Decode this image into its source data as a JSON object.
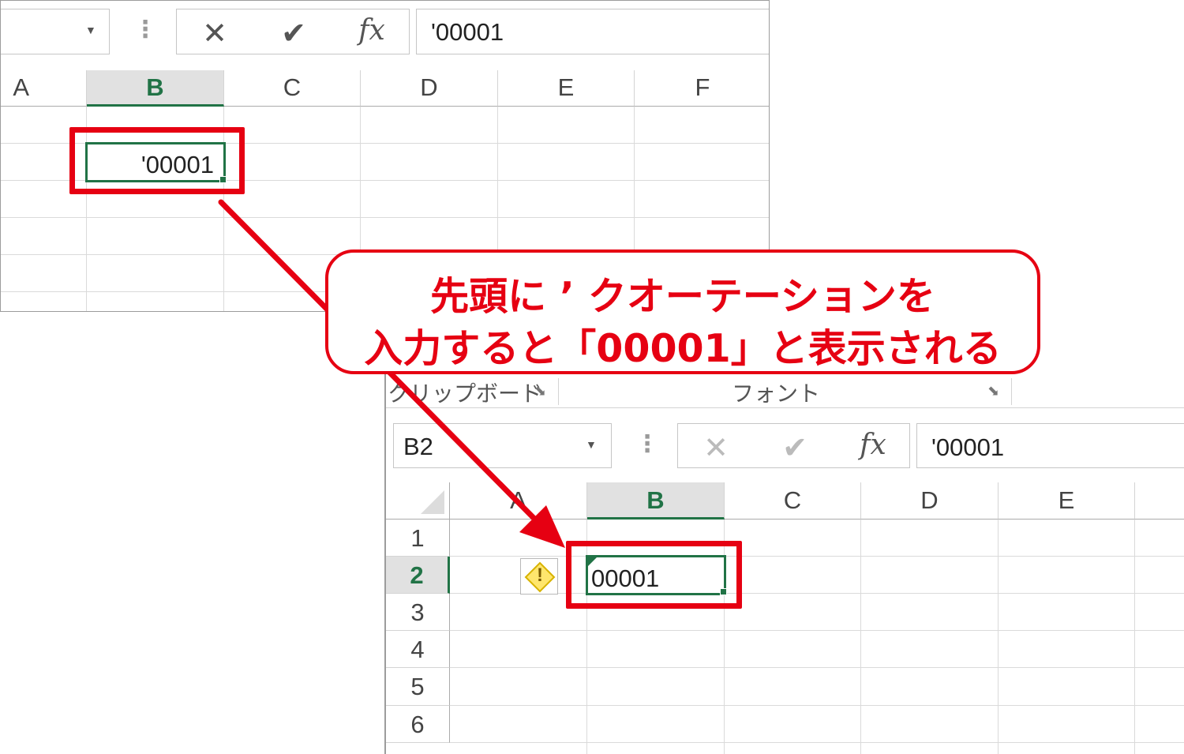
{
  "top_window": {
    "formula_bar": {
      "cancel_glyph": "✕",
      "enter_glyph": "✔",
      "fx_label": "fx",
      "value": "'00001"
    },
    "columns": [
      "A",
      "B",
      "C",
      "D",
      "E",
      "F"
    ],
    "selected_column": "B",
    "cell_b2_value": "'00001"
  },
  "callout": {
    "line1": "先頭に ’ クオーテーションを",
    "line2": "入力すると「00001」と表示される"
  },
  "bottom_window": {
    "ribbon": {
      "clipboard_label": "クリップボード",
      "font_label": "フォント",
      "launcher_glyph": "⬊"
    },
    "name_box": "B2",
    "formula_bar": {
      "cancel_glyph": "✕",
      "enter_glyph": "✔",
      "fx_label": "fx",
      "value": "'00001"
    },
    "columns": [
      "A",
      "B",
      "C",
      "D",
      "E"
    ],
    "rows": [
      "1",
      "2",
      "3",
      "4",
      "5",
      "6"
    ],
    "selected_column": "B",
    "selected_row": "2",
    "warning_glyph": "!",
    "cell_b2_value": "00001"
  },
  "colors": {
    "excel_green": "#217346",
    "annotation_red": "#e60012"
  }
}
